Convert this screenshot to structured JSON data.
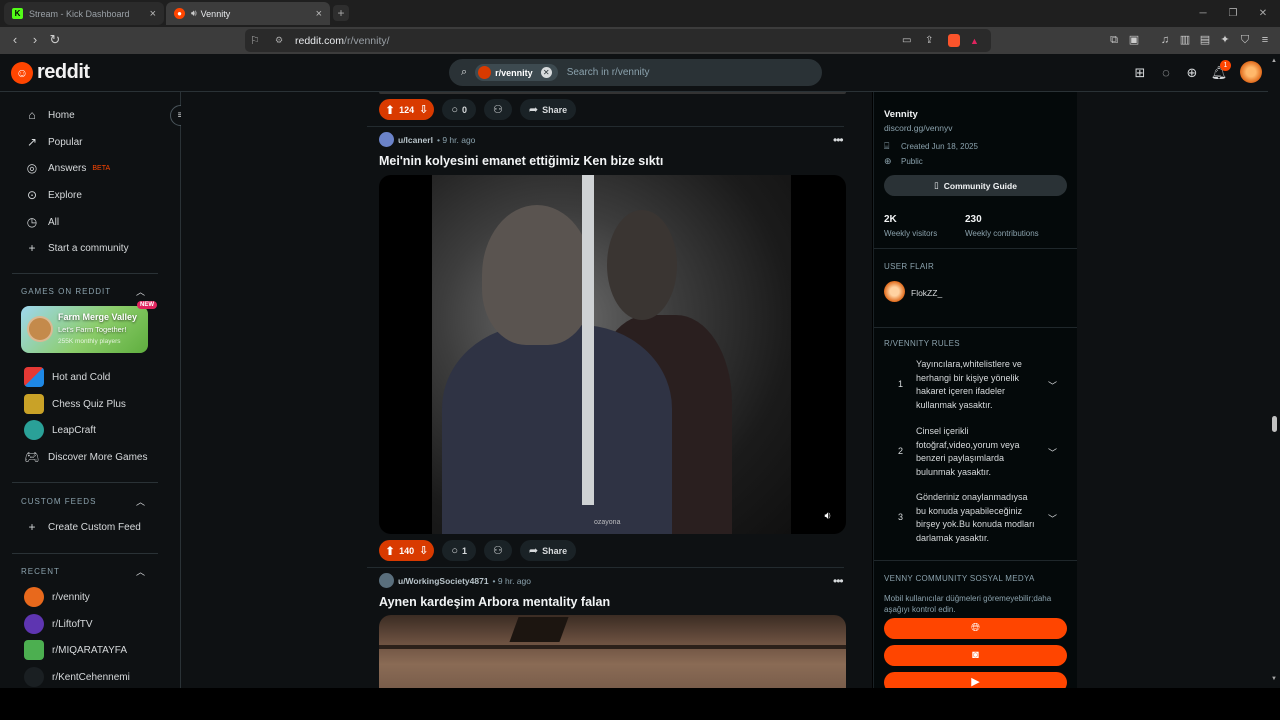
{
  "browser": {
    "tabs": [
      {
        "title": "Stream - Kick Dashboard",
        "icon": "kick-icon",
        "active": false
      },
      {
        "title": "Vennity",
        "icon": "reddit-icon",
        "active": true
      }
    ],
    "url_host": "reddit.com",
    "url_path": "/r/vennity/"
  },
  "header": {
    "logo_text": "reddit",
    "search_chip": "r/vennity",
    "search_placeholder": "Search in r/vennity",
    "notification_count": "1"
  },
  "sidebar": {
    "nav": [
      {
        "label": "Home",
        "icon": "home-icon"
      },
      {
        "label": "Popular",
        "icon": "popular-icon"
      },
      {
        "label": "Answers",
        "icon": "answers-icon",
        "badge": "BETA"
      },
      {
        "label": "Explore",
        "icon": "explore-icon"
      },
      {
        "label": "All",
        "icon": "all-icon"
      },
      {
        "label": "Start a community",
        "icon": "plus-icon"
      }
    ],
    "games_header": "GAMES ON REDDIT",
    "featured_game": {
      "title": "Farm Merge Valley",
      "subtitle": "Let's Farm Together!",
      "players": "255K monthly players",
      "badge": "NEW"
    },
    "games": [
      "Hot and Cold",
      "Chess Quiz Plus",
      "LeapCraft",
      "Discover More Games"
    ],
    "custom_feeds_header": "CUSTOM FEEDS",
    "create_feed": "Create Custom Feed",
    "recent_header": "RECENT",
    "recent": [
      "r/vennity",
      "r/LiftofTV",
      "r/MIQARATAYFA",
      "r/KentCehennemi"
    ]
  },
  "feed": {
    "top_post": {
      "votes": "124",
      "comments": "0",
      "share": "Share"
    },
    "post1": {
      "user": "u/Icanerl",
      "time": "9 hr. ago",
      "title": "Mei'nin kolyesini emanet ettiğimiz Ken bize sıktı",
      "watermark": "ozayona",
      "votes": "140",
      "comments": "1",
      "share": "Share"
    },
    "post2": {
      "user": "u/WorkingSociety4871",
      "time": "9 hr. ago",
      "title": "Aynen kardeşim Arbora mentality falan"
    }
  },
  "community": {
    "name": "Vennity",
    "link": "discord.gg/vennyv",
    "created": "Created Jun 18, 2025",
    "visibility": "Public",
    "guide_button": "Community Guide",
    "stats": [
      {
        "value": "2K",
        "label": "Weekly visitors"
      },
      {
        "value": "230",
        "label": "Weekly contributions"
      }
    ],
    "user_flair_header": "USER FLAIR",
    "flair_name": "FlokZZ_",
    "rules_header": "R/VENNITY RULES",
    "rules": [
      {
        "num": "1",
        "text": "Yayıncılara,whitelistlere ve herhangi bir kişiye yönelik hakaret içeren ifadeler kullanmak yasaktır."
      },
      {
        "num": "2",
        "text": "Cinsel içerikli fotoğraf,video,yorum veya benzeri paylaşımlarda bulunmak yasaktır."
      },
      {
        "num": "3",
        "text": "Gönderiniz onaylanmadıysa bu konuda yapabileceğiniz birşey yok.Bu konuda modları darlamak yasaktır."
      }
    ],
    "social_header": "VENNY COMMUNITY SOSYAL MEDYA",
    "social_note": "Mobil kullanıcılar düğmeleri göremeyebilir;daha aşağıyı kontrol edin.",
    "social_buttons": [
      "globe-icon",
      "discord-icon",
      "youtube-icon"
    ]
  },
  "colors": {
    "accent": "#ff4500",
    "vote_bg": "#d93a00",
    "page_bg": "#0e1113"
  }
}
